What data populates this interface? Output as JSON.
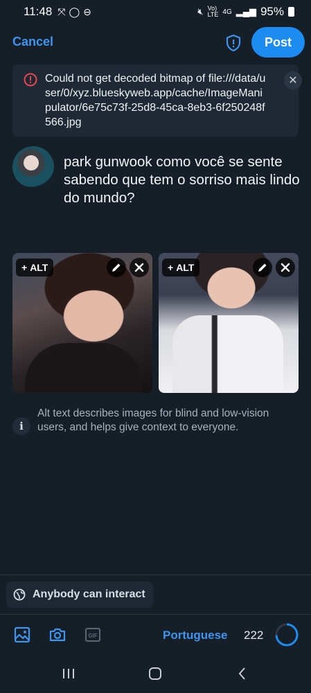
{
  "status_bar": {
    "time": "11:48",
    "battery": "95%",
    "network": "4G"
  },
  "header": {
    "cancel_label": "Cancel",
    "post_label": "Post"
  },
  "error": {
    "message": "Could not get decoded bitmap of file:///data/user/0/xyz.blueskyweb.app/cache/ImageManipulator/6e75c73f-25d8-45ca-8eb3-6f250248f566.jpg"
  },
  "post": {
    "text": "park gunwook como você se sente sabendo que tem o sorriso mais lindo do mundo?"
  },
  "images": [
    {
      "alt_label": "ALT"
    },
    {
      "alt_label": "ALT"
    }
  ],
  "alt_info": {
    "text": "Alt text describes images for blind and low-vision users, and helps give context to everyone."
  },
  "interaction": {
    "label": "Anybody can interact"
  },
  "toolbar": {
    "language": "Portuguese",
    "char_count": "222",
    "char_progress": 0.74
  },
  "colors": {
    "accent": "#1c8cf2",
    "link": "#3f95f0",
    "background": "#161e27",
    "error": "#e5484d"
  }
}
